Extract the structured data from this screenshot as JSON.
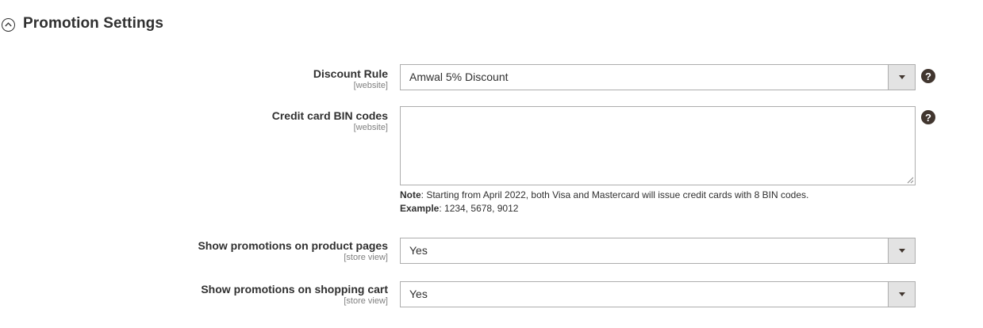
{
  "section": {
    "title": "Promotion Settings"
  },
  "fields": {
    "discount_rule": {
      "label": "Discount Rule",
      "scope": "[website]",
      "value": "Amwal 5% Discount",
      "help": "?"
    },
    "bin_codes": {
      "label": "Credit card BIN codes",
      "scope": "[website]",
      "value": "",
      "help": "?",
      "note_label": "Note",
      "note_text": ": Starting from April 2022, both Visa and Mastercard will issue credit cards with 8 BIN codes.",
      "example_label": "Example",
      "example_text": ": 1234, 5678, 9012"
    },
    "show_product": {
      "label": "Show promotions on product pages",
      "scope": "[store view]",
      "value": "Yes"
    },
    "show_cart": {
      "label": "Show promotions on shopping cart",
      "scope": "[store view]",
      "value": "Yes"
    }
  },
  "colors": {
    "text": "#303030",
    "scope": "#808080",
    "border": "#adadad",
    "arrow_bg": "#e3e3e3",
    "help_bg": "#41362f"
  }
}
